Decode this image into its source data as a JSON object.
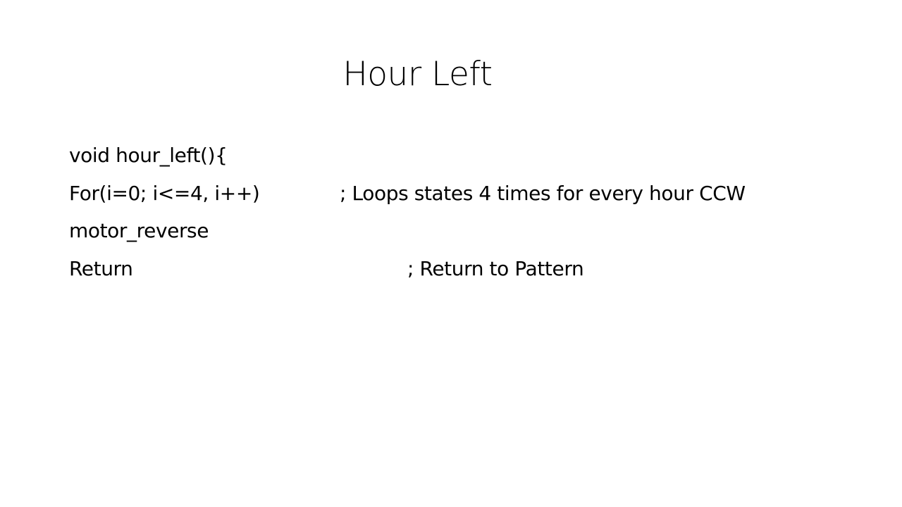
{
  "slide": {
    "title": "Hour Left",
    "lines": [
      {
        "code": "void hour_left(){",
        "comment": ""
      },
      {
        "code": "For(i=0; i<=4, i++)",
        "comment": "; Loops states 4 times for every hour CCW"
      },
      {
        "code": "motor_reverse",
        "comment": ""
      },
      {
        "code": "Return",
        "comment": "; Return to Pattern"
      }
    ]
  }
}
